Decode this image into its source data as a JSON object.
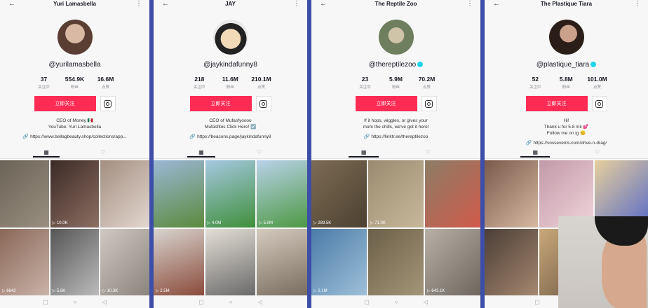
{
  "panels": [
    {
      "title": "Yuri Lamasbella",
      "handle": "@yurilamasbella",
      "verified": false,
      "stats": [
        {
          "num": "37",
          "lbl": "关注中"
        },
        {
          "num": "554.9K",
          "lbl": "粉丝"
        },
        {
          "num": "16.6M",
          "lbl": "点赞"
        }
      ],
      "follow_label": "立即关注",
      "bio": [
        "CEO of Money 🇲🇽",
        "YouTube: Yuri Lamasbella"
      ],
      "link": "https://www.bellagbeauty.shop/collections/app...",
      "views": [
        "",
        "10.0K",
        "",
        "6642",
        "5.8K",
        "10.3K"
      ]
    },
    {
      "title": "JAY",
      "handle": "@jaykindafunny8",
      "verified": false,
      "stats": [
        {
          "num": "218",
          "lbl": "关注中"
        },
        {
          "num": "11.6M",
          "lbl": "粉丝"
        },
        {
          "num": "210.1M",
          "lbl": "点赞"
        }
      ],
      "follow_label": "立即关注",
      "bio": [
        "CEO of Mufasfyoooo",
        "Mufasfitos Click Here! ↙️"
      ],
      "link": "https://beacons.page/jaykindafunny8",
      "views": [
        "",
        "4.0M",
        "5.0M",
        "2.5M",
        "",
        ""
      ]
    },
    {
      "title": "The Reptile Zoo",
      "handle": "@thereptilezoo",
      "verified": true,
      "stats": [
        {
          "num": "23",
          "lbl": "关注中"
        },
        {
          "num": "5.9M",
          "lbl": "粉丝"
        },
        {
          "num": "70.2M",
          "lbl": "点赞"
        }
      ],
      "follow_label": "立即关注",
      "bio": [
        "If it hops, wiggles, or gives your",
        "mom the chills, we've got it here!"
      ],
      "link": "https://linktr.ee/thereptilezoo",
      "views": [
        "289.5K",
        "71.0K",
        "",
        "2.1M",
        "",
        "643.1K"
      ]
    },
    {
      "title": "The Plastique Tiara",
      "handle": "@plastique_tiara",
      "verified": true,
      "stats": [
        {
          "num": "52",
          "lbl": "关注中"
        },
        {
          "num": "5.8M",
          "lbl": "粉丝"
        },
        {
          "num": "101.0M",
          "lbl": "点赞"
        }
      ],
      "follow_label": "立即关注",
      "bio": [
        "Hi!",
        "Thank u for 5.8 mil 💕",
        "Follow me on ig 😊"
      ],
      "link": "https://vossevents.com/drive-n-drag/",
      "views": [
        "",
        "",
        "",
        "",
        "",
        ""
      ]
    }
  ],
  "colors": {
    "follow_button": "#fe2c55",
    "background": "#3d4ea8"
  },
  "icons": {
    "back": "arrow-left-icon",
    "more": "more-vertical-icon",
    "insta": "instagram-icon",
    "link": "link-icon",
    "grid": "grid-icon",
    "liked": "liked-icon"
  }
}
